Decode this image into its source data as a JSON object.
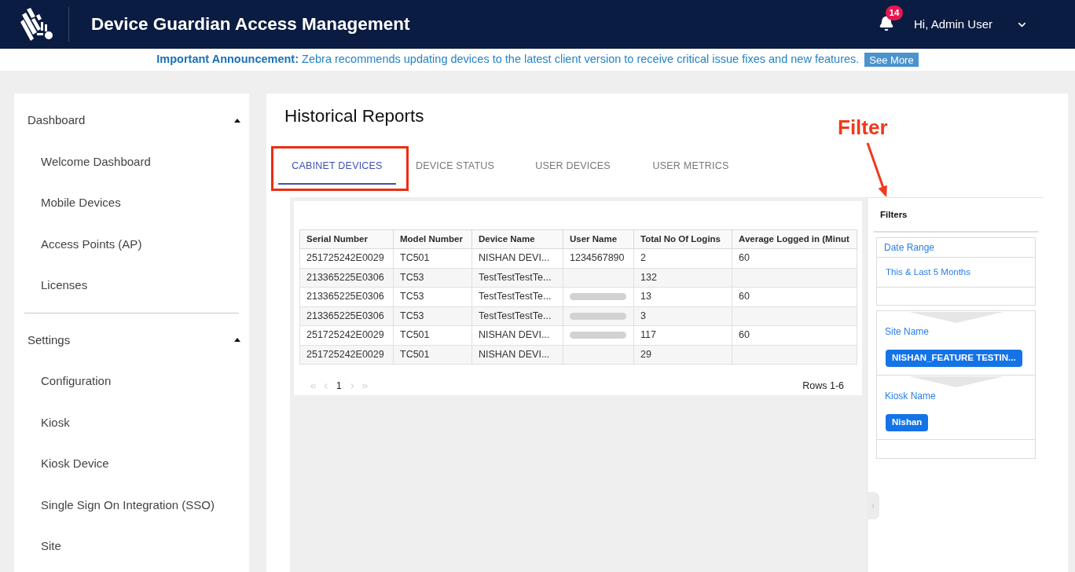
{
  "header": {
    "title": "Device Guardian Access Management",
    "notification_count": "14",
    "greeting": "Hi, Admin User"
  },
  "announcement": {
    "label": "Important Announcement:",
    "message": "Zebra recommends updating devices to the latest client version to receive critical issue fixes and new features.",
    "button": "See More"
  },
  "sidebar": {
    "sections": [
      {
        "title": "Dashboard",
        "expanded": true,
        "items": [
          {
            "label": "Welcome Dashboard",
            "selected": false
          },
          {
            "label": "Mobile Devices",
            "selected": false
          },
          {
            "label": "Access Points (AP)",
            "selected": false
          },
          {
            "label": "Licenses",
            "selected": false
          }
        ]
      },
      {
        "title": "Settings",
        "expanded": true,
        "items": [
          {
            "label": "Configuration",
            "selected": false
          },
          {
            "label": "Kiosk",
            "selected": false
          },
          {
            "label": "Kiosk Device",
            "selected": false
          },
          {
            "label": "Single Sign On Integration (SSO)",
            "selected": false
          },
          {
            "label": "Site",
            "selected": false
          }
        ]
      }
    ]
  },
  "page": {
    "title": "Historical Reports"
  },
  "tabs": [
    {
      "label": "CABINET DEVICES",
      "selected": true
    },
    {
      "label": "DEVICE STATUS",
      "selected": false
    },
    {
      "label": "USER DEVICES",
      "selected": false
    },
    {
      "label": "USER METRICS",
      "selected": false
    }
  ],
  "table": {
    "columns": [
      "Serial Number",
      "Model Number",
      "Device Name",
      "User Name",
      "Total No Of Logins",
      "Average Logged in (Minut"
    ],
    "rows": [
      {
        "serial_number": "251725242E0029",
        "model_number": "TC501",
        "device_name": "NISHAN DEVI...",
        "user_name": "1234567890",
        "user_name_blurred": false,
        "total_logins": "2",
        "average_logged_in": "60"
      },
      {
        "serial_number": "213365225E0306",
        "model_number": "TC53",
        "device_name": "TestTestTestTe...",
        "user_name_blurred": false,
        "total_logins": "132"
      },
      {
        "serial_number": "213365225E0306",
        "model_number": "TC53",
        "device_name": "TestTestTestTe...",
        "user_name_blurred": true,
        "total_logins": "13",
        "average_logged_in": "60"
      },
      {
        "serial_number": "213365225E0306",
        "model_number": "TC53",
        "device_name": "TestTestTestTe...",
        "user_name_blurred": true,
        "total_logins": "3"
      },
      {
        "serial_number": "251725242E0029",
        "model_number": "TC501",
        "device_name": "NISHAN DEVI...",
        "user_name_blurred": true,
        "total_logins": "117",
        "average_logged_in": "60"
      },
      {
        "serial_number": "251725242E0029",
        "model_number": "TC501",
        "device_name": "NISHAN DEVI...",
        "user_name_blurred": false,
        "total_logins": "29"
      }
    ]
  },
  "pagination": {
    "page": "1",
    "rows_label": "Rows 1-6"
  },
  "filters": {
    "title": "Filters",
    "date_range": {
      "label": "Date Range",
      "value": "This & Last 5 Months"
    },
    "groups": [
      {
        "label": "Site Name",
        "chips": [
          "NISHAN_FEATURE TESTIN..."
        ]
      },
      {
        "label": "Kiosk Name",
        "chips": [
          "Nishan"
        ]
      }
    ]
  },
  "annotation": {
    "label": "Filter"
  }
}
